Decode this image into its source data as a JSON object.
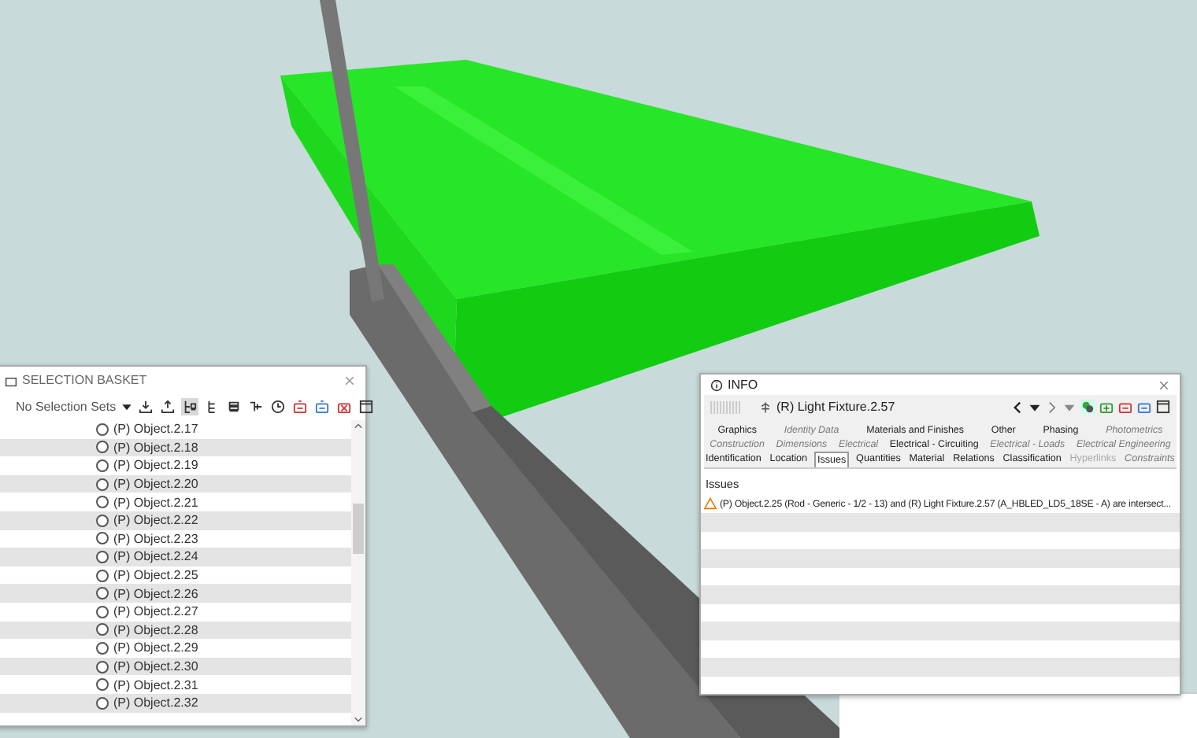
{
  "selection_basket": {
    "title": "SELECTION BASKET",
    "selection_sets": "No Selection Sets",
    "toolbar_buttons": [
      {
        "selected": false
      },
      {
        "selected": false
      },
      {
        "selected": true
      },
      {
        "selected": false
      },
      {
        "selected": false
      },
      {
        "selected": false
      },
      {
        "selected": false
      },
      {
        "selected": false
      },
      {
        "selected": false
      },
      {
        "selected": false
      },
      {
        "selected": false
      }
    ],
    "items": [
      {
        "label": "(P) Object.2.17",
        "selected": false
      },
      {
        "label": "(P) Object.2.18",
        "selected": false
      },
      {
        "label": "(P) Object.2.19",
        "selected": false
      },
      {
        "label": "(P) Object.2.20",
        "selected": false
      },
      {
        "label": "(P) Object.2.21",
        "selected": false
      },
      {
        "label": "(P) Object.2.22",
        "selected": false
      },
      {
        "label": "(P) Object.2.23",
        "selected": false
      },
      {
        "label": "(P) Object.2.24",
        "selected": false
      },
      {
        "label": "(P) Object.2.25",
        "selected": false
      },
      {
        "label": "(P) Object.2.26",
        "selected": false
      },
      {
        "label": "(P) Object.2.27",
        "selected": false
      },
      {
        "label": "(P) Object.2.28",
        "selected": false
      },
      {
        "label": "(P) Object.2.29",
        "selected": false
      },
      {
        "label": "(P) Object.2.30",
        "selected": false
      },
      {
        "label": "(P) Object.2.31",
        "selected": false
      },
      {
        "label": "(P) Object.2.32",
        "selected": false
      }
    ]
  },
  "info": {
    "title": "INFO",
    "object": "(R) Light Fixture.2.57",
    "tab_rows": [
      [
        {
          "label": "Graphics",
          "kind": "normal",
          "selected": false
        },
        {
          "label": "Identity Data",
          "kind": "italic",
          "selected": false
        },
        {
          "label": "Materials and Finishes",
          "kind": "normal",
          "selected": false
        },
        {
          "label": "Other",
          "kind": "normal",
          "selected": false
        },
        {
          "label": "Phasing",
          "kind": "normal",
          "selected": false
        },
        {
          "label": "Photometrics",
          "kind": "italic",
          "selected": false
        }
      ],
      [
        {
          "label": "Construction",
          "kind": "italic",
          "selected": false
        },
        {
          "label": "Dimensions",
          "kind": "italic",
          "selected": false
        },
        {
          "label": "Electrical",
          "kind": "italic",
          "selected": false
        },
        {
          "label": "Electrical - Circuiting",
          "kind": "normal",
          "selected": false
        },
        {
          "label": "Electrical - Loads",
          "kind": "italic",
          "selected": false
        },
        {
          "label": "Electrical Engineering",
          "kind": "italic",
          "selected": false
        }
      ],
      [
        {
          "label": "Identification",
          "kind": "normal",
          "selected": false
        },
        {
          "label": "Location",
          "kind": "normal",
          "selected": false
        },
        {
          "label": "Issues",
          "kind": "normal",
          "selected": true
        },
        {
          "label": "Quantities",
          "kind": "normal",
          "selected": false
        },
        {
          "label": "Material",
          "kind": "normal",
          "selected": false
        },
        {
          "label": "Relations",
          "kind": "normal",
          "selected": false
        },
        {
          "label": "Classification",
          "kind": "normal",
          "selected": false
        },
        {
          "label": "Hyperlinks",
          "kind": "disabled",
          "selected": false
        },
        {
          "label": "Constraints",
          "kind": "italic",
          "selected": false
        }
      ]
    ],
    "issues_header": "Issues",
    "issues": [
      {
        "text": "(P) Object.2.25 (Rod - Generic - 1/2 - 13) and (R) Light Fixture.2.57 (A_HBLED_LD5_18SE - A) are intersect..."
      }
    ]
  }
}
